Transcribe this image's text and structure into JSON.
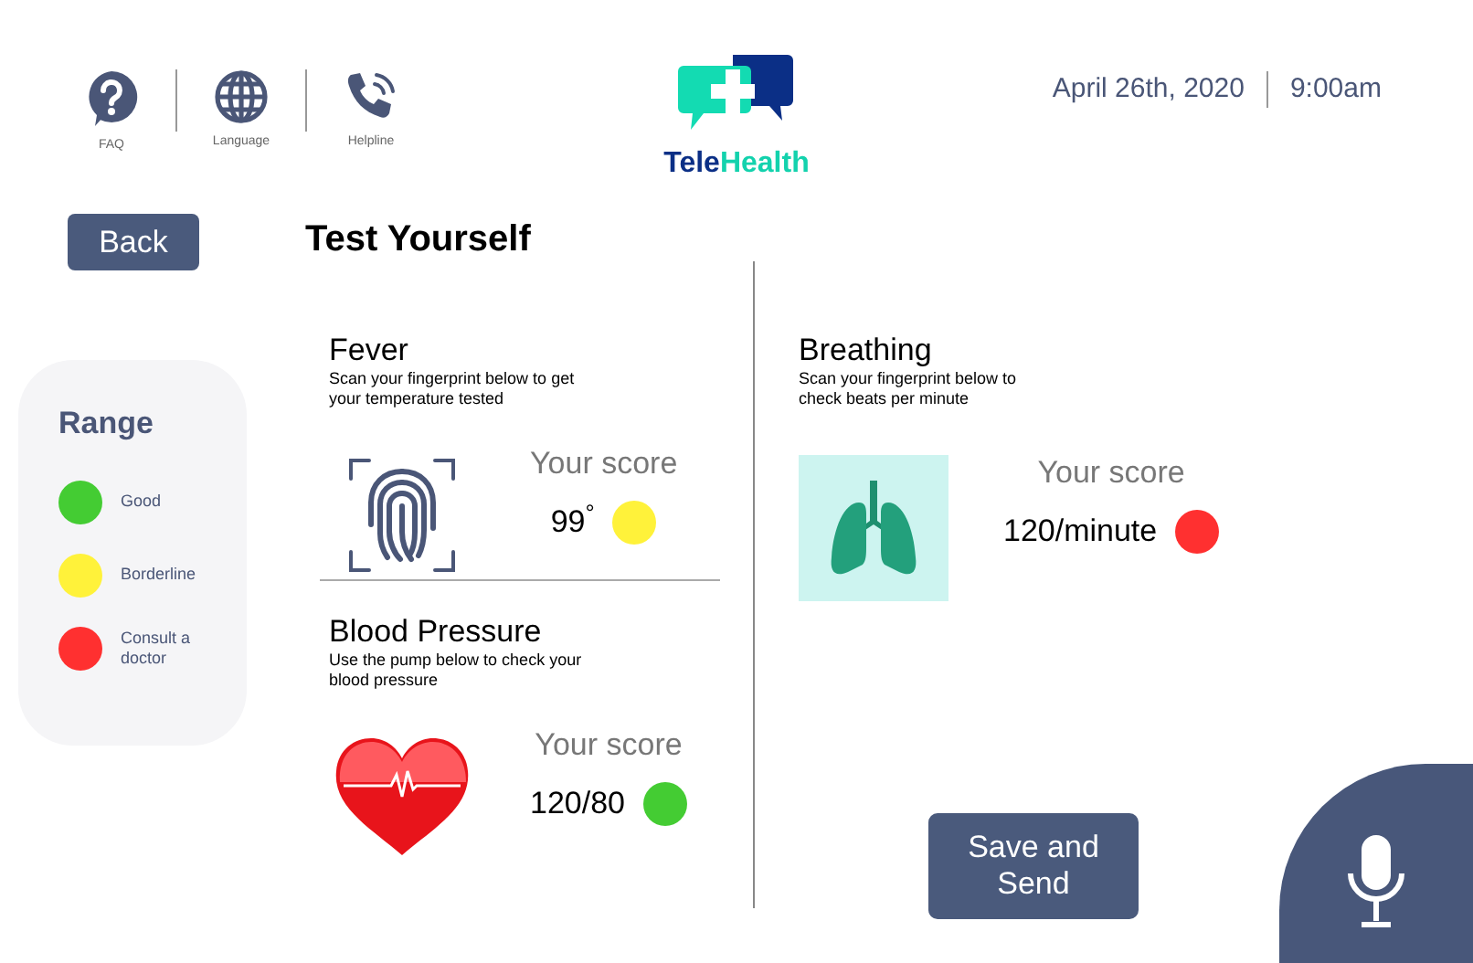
{
  "header": {
    "nav": [
      {
        "label": "FAQ",
        "kind": "faq"
      },
      {
        "label": "Language",
        "kind": "language"
      },
      {
        "label": "Helpline",
        "kind": "helpline"
      }
    ],
    "logo": {
      "part_1": "Tele",
      "part_2": "Health"
    },
    "date": "April 26th, 2020",
    "time": "9:00am"
  },
  "back_button": "Back",
  "range": {
    "title": "Range",
    "items": [
      {
        "label": "Good",
        "color": "#44cc33"
      },
      {
        "label": "Borderline",
        "color": "#fff23a"
      },
      {
        "label": "Consult a doctor",
        "color": "#ff3030"
      }
    ]
  },
  "title": "Test Yourself",
  "tests": [
    {
      "kind": "fever",
      "name": "Fever",
      "instruction": "Scan your fingerprint below to get your temperature tested",
      "score_label": "Your score",
      "score": "99$^{°}$",
      "color": "#fff23a"
    },
    {
      "kind": "blood_pressure",
      "name": "Blood Pressure",
      "instruction": "Use the pump below to check your blood pressure",
      "score_label": "Your score",
      "score": "120/80",
      "color": "#44cc33"
    },
    {
      "kind": "breathing",
      "name": "Breathing",
      "instruction": "Scan your fingerprint below to check beats per minute",
      "score_label": "Your score",
      "score": "120/minute",
      "color": "#ff3030"
    }
  ],
  "save_button": "Save and Send"
}
